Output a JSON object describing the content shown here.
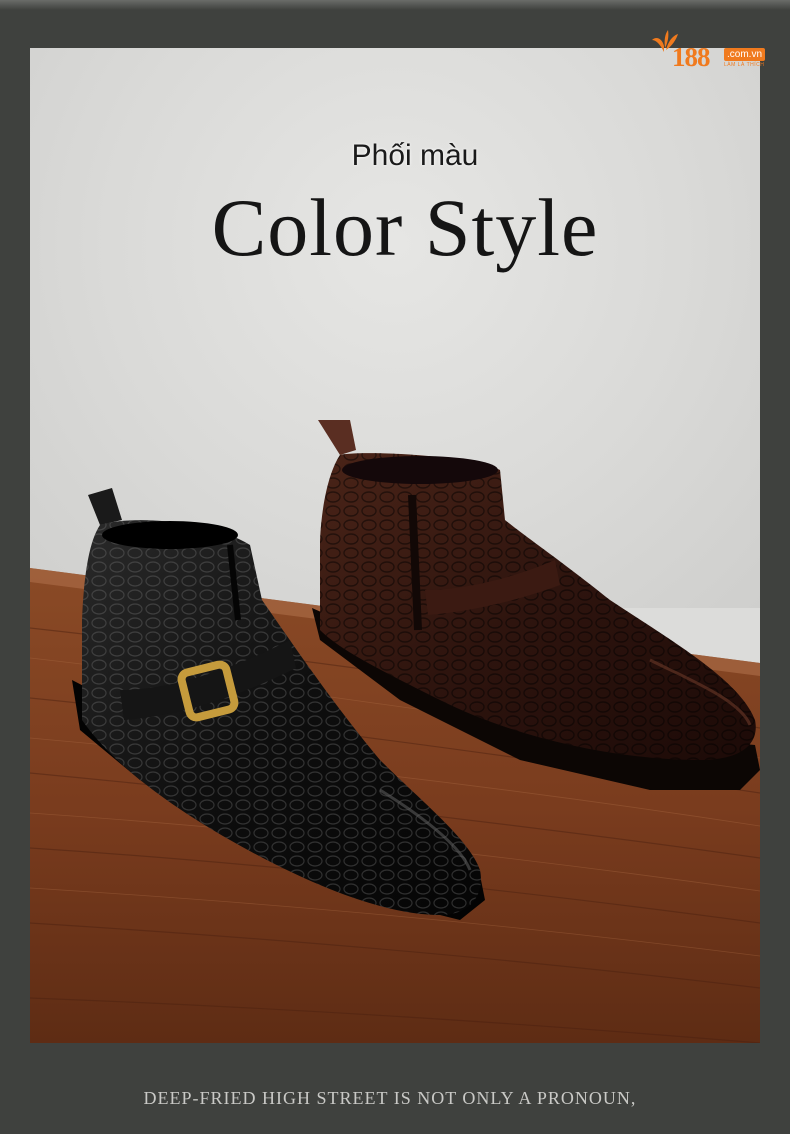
{
  "header": {
    "logo": {
      "number": "188",
      "domain": ".com.vn",
      "tagline": "LÀM LÀ THÍCH",
      "brand_color": "#f07a1e"
    },
    "subtitle": "Phối màu",
    "title": "Color Style"
  },
  "photo": {
    "products": [
      {
        "name": "black-crocodile-buckle-ankle-boot",
        "color": "#0d0d0d",
        "buckle_color": "#c59b3c"
      },
      {
        "name": "brown-crocodile-buckle-ankle-boot",
        "color": "#3a1a14"
      }
    ],
    "floor_color": "#7a3c1e",
    "wall_color": "#dcdcda"
  },
  "footer": {
    "text": "DEEP-FRIED HIGH STREET IS NOT ONLY A PRONOUN,"
  }
}
